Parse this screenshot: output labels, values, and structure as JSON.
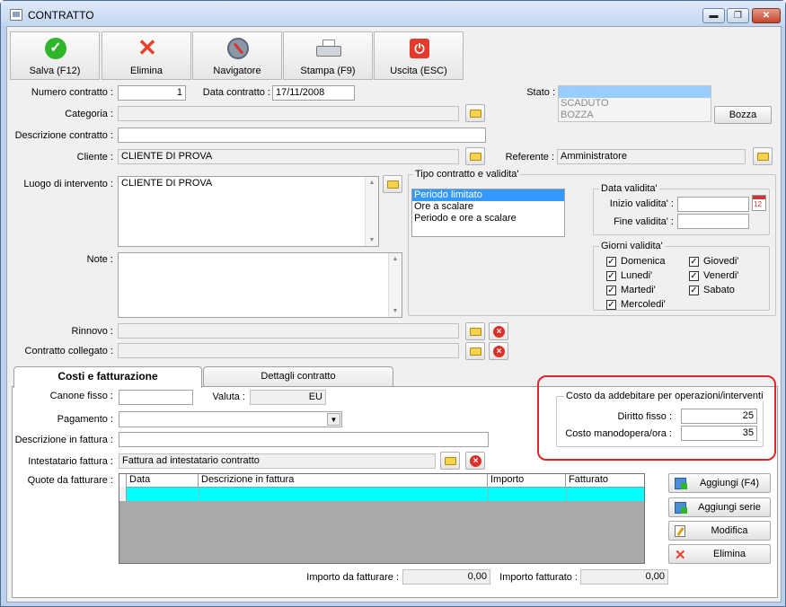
{
  "window": {
    "title": "CONTRATTO",
    "minimize": "▬",
    "restore": "❐",
    "close": "✕"
  },
  "toolbar": [
    {
      "label": "Salva (F12)",
      "icon": "check-icon"
    },
    {
      "label": "Elimina",
      "icon": "delete-x-icon"
    },
    {
      "label": "Navigatore",
      "icon": "compass-icon"
    },
    {
      "label": "Stampa (F9)",
      "icon": "printer-icon"
    },
    {
      "label": "Uscita (ESC)",
      "icon": "power-icon"
    }
  ],
  "form": {
    "numero_label": "Numero contratto :",
    "numero_value": "1",
    "data_label": "Data contratto :",
    "data_value": "17/11/2008",
    "stato_label": "Stato :",
    "stato_options": [
      "ATTIVO",
      "SCADUTO",
      "BOZZA"
    ],
    "bozza_button": "Bozza",
    "categoria_label": "Categoria :",
    "categoria_value": "",
    "descrizione_label": "Descrizione contratto :",
    "descrizione_value": "",
    "cliente_label": "Cliente :",
    "cliente_value": "CLIENTE DI PROVA",
    "referente_label": "Referente :",
    "referente_value": "Amministratore",
    "luogo_label": "Luogo di intervento :",
    "luogo_value": "CLIENTE DI PROVA",
    "note_label": "Note :",
    "note_value": "",
    "rinnovo_label": "Rinnovo :",
    "rinnovo_value": "",
    "collegato_label": "Contratto collegato :",
    "collegato_value": ""
  },
  "tipo": {
    "title": "Tipo contratto e validita'",
    "options": [
      "Periodo limitato",
      "Ore a scalare",
      "Periodo e ore a scalare"
    ],
    "selected_index": 0,
    "data_group_title": "Data validita'",
    "inizio_label": "Inizio validita' :",
    "inizio_value": "",
    "fine_label": "Fine validita' :",
    "fine_value": "",
    "calendar_text": "12",
    "giorni_title": "Giorni validita'",
    "giorni": [
      {
        "label": "Domenica",
        "checked": true
      },
      {
        "label": "Giovedi'",
        "checked": true
      },
      {
        "label": "Lunedi'",
        "checked": true
      },
      {
        "label": "Venerdi'",
        "checked": true
      },
      {
        "label": "Martedi'",
        "checked": true
      },
      {
        "label": "Sabato",
        "checked": true
      },
      {
        "label": "Mercoledi'",
        "checked": true
      }
    ],
    "check_mark": "✓"
  },
  "tabs": [
    {
      "label": "Costi e fatturazione",
      "active": true
    },
    {
      "label": "Dettagli contratto",
      "active": false
    }
  ],
  "costi": {
    "canone_label": "Canone fisso :",
    "canone_value": "",
    "valuta_label": "Valuta :",
    "valuta_value": "EU",
    "pagamento_label": "Pagamento :",
    "pagamento_value": "",
    "dropdown_arrow": "▼",
    "descr_fattura_label": "Descrizione in fattura :",
    "descr_fattura_value": "",
    "intestatario_label": "Intestatario fattura :",
    "intestatario_value": "Fattura ad intestatario contratto",
    "quote_label": "Quote da fatturare :",
    "grid_columns": [
      "Data",
      "Descrizione in fattura",
      "Importo",
      "Fatturato"
    ],
    "operazioni_title": "Costo da addebitare per operazioni/interventi",
    "diritto_label": "Diritto fisso :",
    "diritto_value": "25",
    "manodopera_label": "Costo manodopera/ora :",
    "manodopera_value": "35",
    "buttons": [
      {
        "label": "Aggiungi (F4)",
        "icon": "add-icon"
      },
      {
        "label": "Aggiungi serie",
        "icon": "add-series-icon"
      },
      {
        "label": "Modifica",
        "icon": "edit-icon"
      },
      {
        "label": "Elimina",
        "icon": "delete-x-icon"
      }
    ],
    "importo_da_label": "Importo da fatturare :",
    "importo_da_value": "0,00",
    "importo_fatt_label": "Importo fatturato :",
    "importo_fatt_value": "0,00"
  },
  "colors": {
    "highlight_box": "#e0262b",
    "row_cyan": "#00ffff",
    "selection": "#3399ff"
  }
}
